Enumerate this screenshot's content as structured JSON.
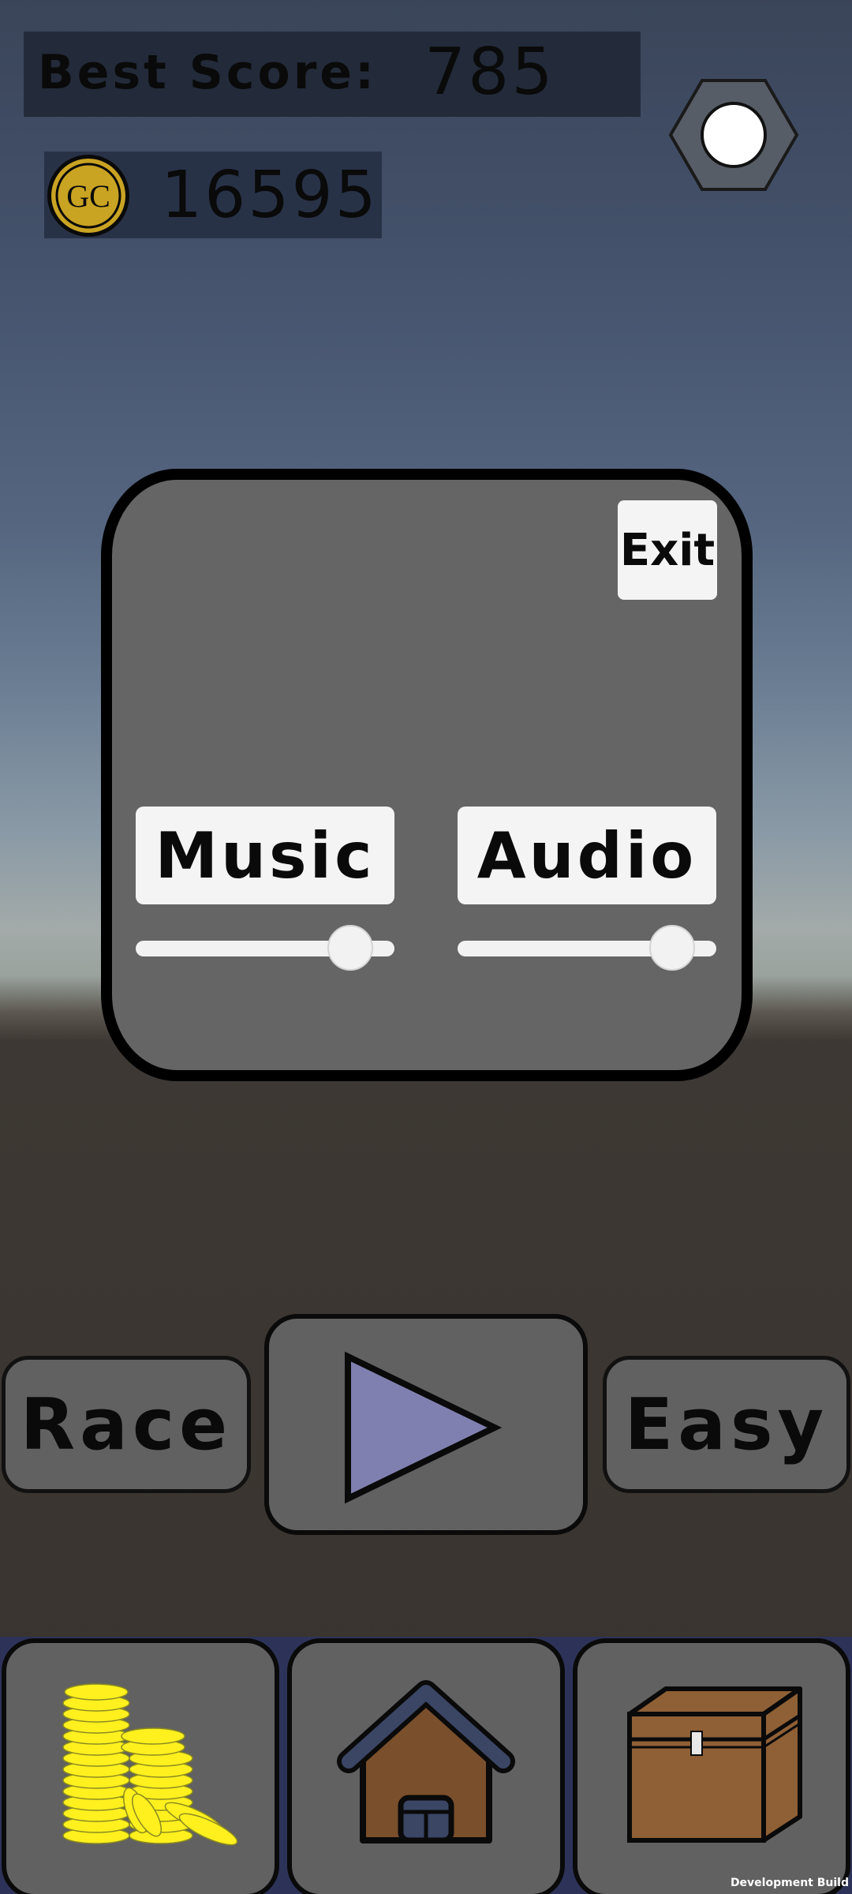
{
  "hud": {
    "best_score_label": "Best Score:",
    "best_score_value": "785",
    "coin_icon_text": "GC",
    "coin_count": "16595"
  },
  "settings": {
    "exit_label": "Exit",
    "music_label": "Music",
    "audio_label": "Audio",
    "music_volume": 0.9,
    "audio_volume": 0.9
  },
  "controls": {
    "mode_label": "Race",
    "difficulty_label": "Easy"
  },
  "footer": {
    "build_label": "Development Build"
  },
  "colors": {
    "play_triangle": "#8080b0",
    "coin_gold": "#c9a322",
    "coins_yellow": "#fff01e",
    "chest_brown": "#8f5f35",
    "garage_brown": "#7a4f2b",
    "roof_blue": "#3b4665"
  },
  "icons": [
    "gear-icon",
    "gc-coin-icon",
    "play-icon",
    "coin-stack-icon",
    "garage-icon",
    "chest-icon"
  ]
}
